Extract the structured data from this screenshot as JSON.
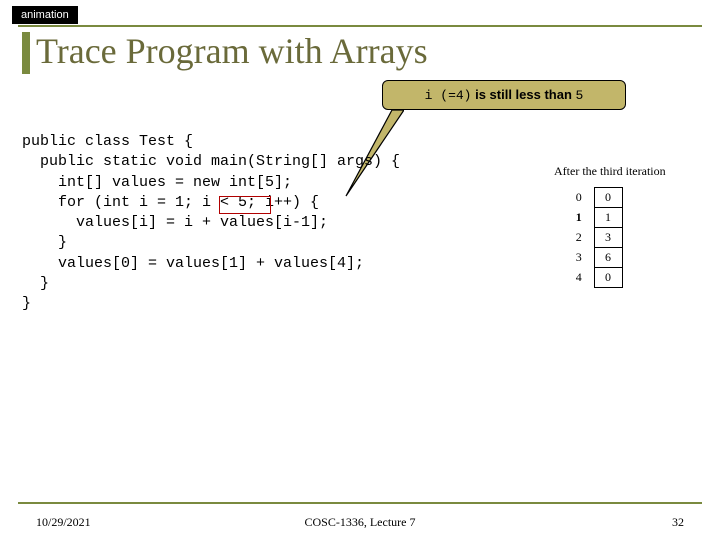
{
  "tag": "animation",
  "title": "Trace Program with Arrays",
  "callout": {
    "i_text": "i",
    "i_val": " (=4)",
    "mid": " is still less than ",
    "limit": "5"
  },
  "code": "public class Test {\n  public static void main(String[] args) {\n    int[] values = new int[5];\n    for (int i = 1; i < 5; i++) {\n      values[i] = i + values[i-1];\n    }\n    values[0] = values[1] + values[4];\n  }\n}",
  "diagram": {
    "caption": "After the third iteration",
    "rows": [
      {
        "index": "0",
        "bold": false,
        "value": "0"
      },
      {
        "index": "1",
        "bold": true,
        "value": "1"
      },
      {
        "index": "2",
        "bold": false,
        "value": "3"
      },
      {
        "index": "3",
        "bold": false,
        "value": "6"
      },
      {
        "index": "4",
        "bold": false,
        "value": "0"
      }
    ]
  },
  "footer": {
    "date": "10/29/2021",
    "course": "COSC-1336, Lecture 7",
    "page": "32"
  }
}
